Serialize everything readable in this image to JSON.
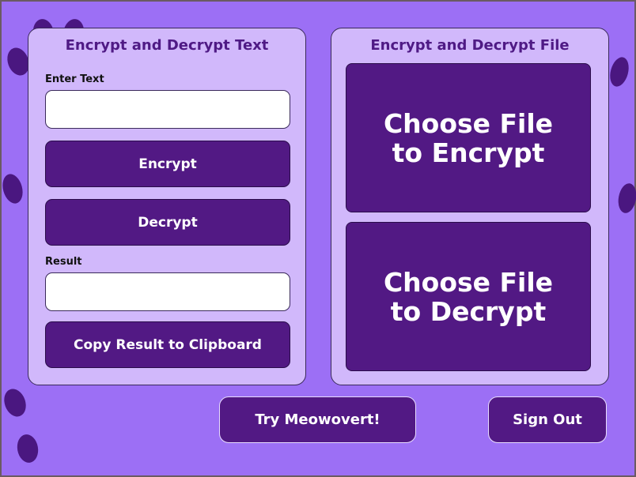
{
  "text_panel": {
    "title": "Encrypt and Decrypt Text",
    "input_label": "Enter Text",
    "input_value": "",
    "encrypt_label": "Encrypt",
    "decrypt_label": "Decrypt",
    "result_label": "Result",
    "result_value": "",
    "copy_label": "Copy Result to Clipboard"
  },
  "file_panel": {
    "title": "Encrypt and Decrypt File",
    "encrypt_line1": "Choose File",
    "encrypt_line2": "to Encrypt",
    "decrypt_line1": "Choose File",
    "decrypt_line2": "to Decrypt"
  },
  "footer": {
    "try_label": "Try Meowovert!",
    "signout_label": "Sign Out"
  },
  "colors": {
    "background": "#9c6ff5",
    "panel": "#d1b8fb",
    "button": "#521984",
    "title": "#4f1a85"
  }
}
